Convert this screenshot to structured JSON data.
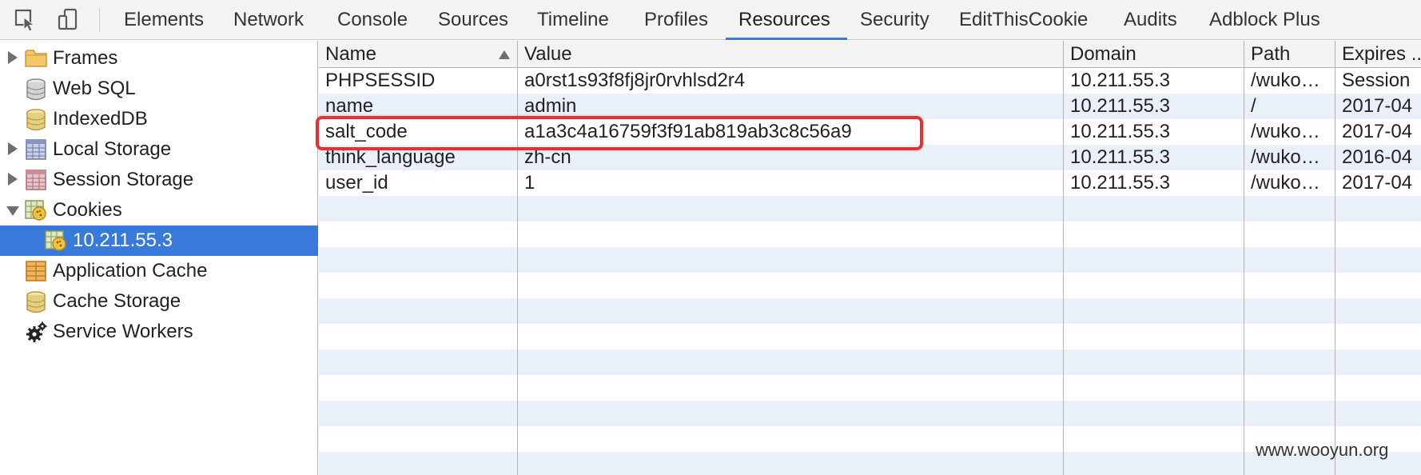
{
  "toolbar": {
    "tabs": [
      "Elements",
      "Network",
      "Console",
      "Sources",
      "Timeline",
      "Profiles",
      "Resources",
      "Security",
      "EditThisCookie",
      "Audits",
      "Adblock Plus"
    ],
    "active_tab": "Resources",
    "accent_color": "#3879d9"
  },
  "sidebar": {
    "items": [
      {
        "label": "Frames",
        "icon": "folder-icon",
        "expandable": "collapsed"
      },
      {
        "label": "Web SQL",
        "icon": "database-icon",
        "expandable": "none"
      },
      {
        "label": "IndexedDB",
        "icon": "database-icon",
        "expandable": "none"
      },
      {
        "label": "Local Storage",
        "icon": "storage-grid-icon",
        "expandable": "collapsed"
      },
      {
        "label": "Session Storage",
        "icon": "storage-grid-icon",
        "expandable": "collapsed"
      },
      {
        "label": "Cookies",
        "icon": "cookie-icon",
        "expandable": "expanded"
      },
      {
        "label": "10.211.55.3",
        "icon": "cookie-icon",
        "expandable": "none",
        "selected": true
      },
      {
        "label": "Application Cache",
        "icon": "app-cache-icon",
        "expandable": "none"
      },
      {
        "label": "Cache Storage",
        "icon": "database-icon",
        "expandable": "none"
      },
      {
        "label": "Service Workers",
        "icon": "gear-icon",
        "expandable": "none"
      }
    ]
  },
  "grid": {
    "columns": [
      "Name",
      "Value",
      "Domain",
      "Path",
      "Expires ..."
    ],
    "sort": {
      "column": "Name",
      "direction": "ascending"
    },
    "rows": [
      [
        "PHPSESSID",
        "a0rst1s93f8fj8jr0rvhlsd2r4",
        "10.211.55.3",
        "/wuko…",
        "Session"
      ],
      [
        "name",
        "admin",
        "10.211.55.3",
        "/",
        "2017-04"
      ],
      [
        "salt_code",
        "a1a3c4a16759f3f91ab819ab3c8c56a9",
        "10.211.55.3",
        "/wuko…",
        "2017-04"
      ],
      [
        "think_language",
        "zh-cn",
        "10.211.55.3",
        "/wuko…",
        "2016-04"
      ],
      [
        "user_id",
        "1",
        "10.211.55.3",
        "/wuko…",
        "2017-04"
      ]
    ],
    "highlighted_row": "salt_code",
    "highlight_color": "#e53131",
    "stripe_color": "#eaf0fa"
  },
  "watermark": "www.wooyun.org"
}
